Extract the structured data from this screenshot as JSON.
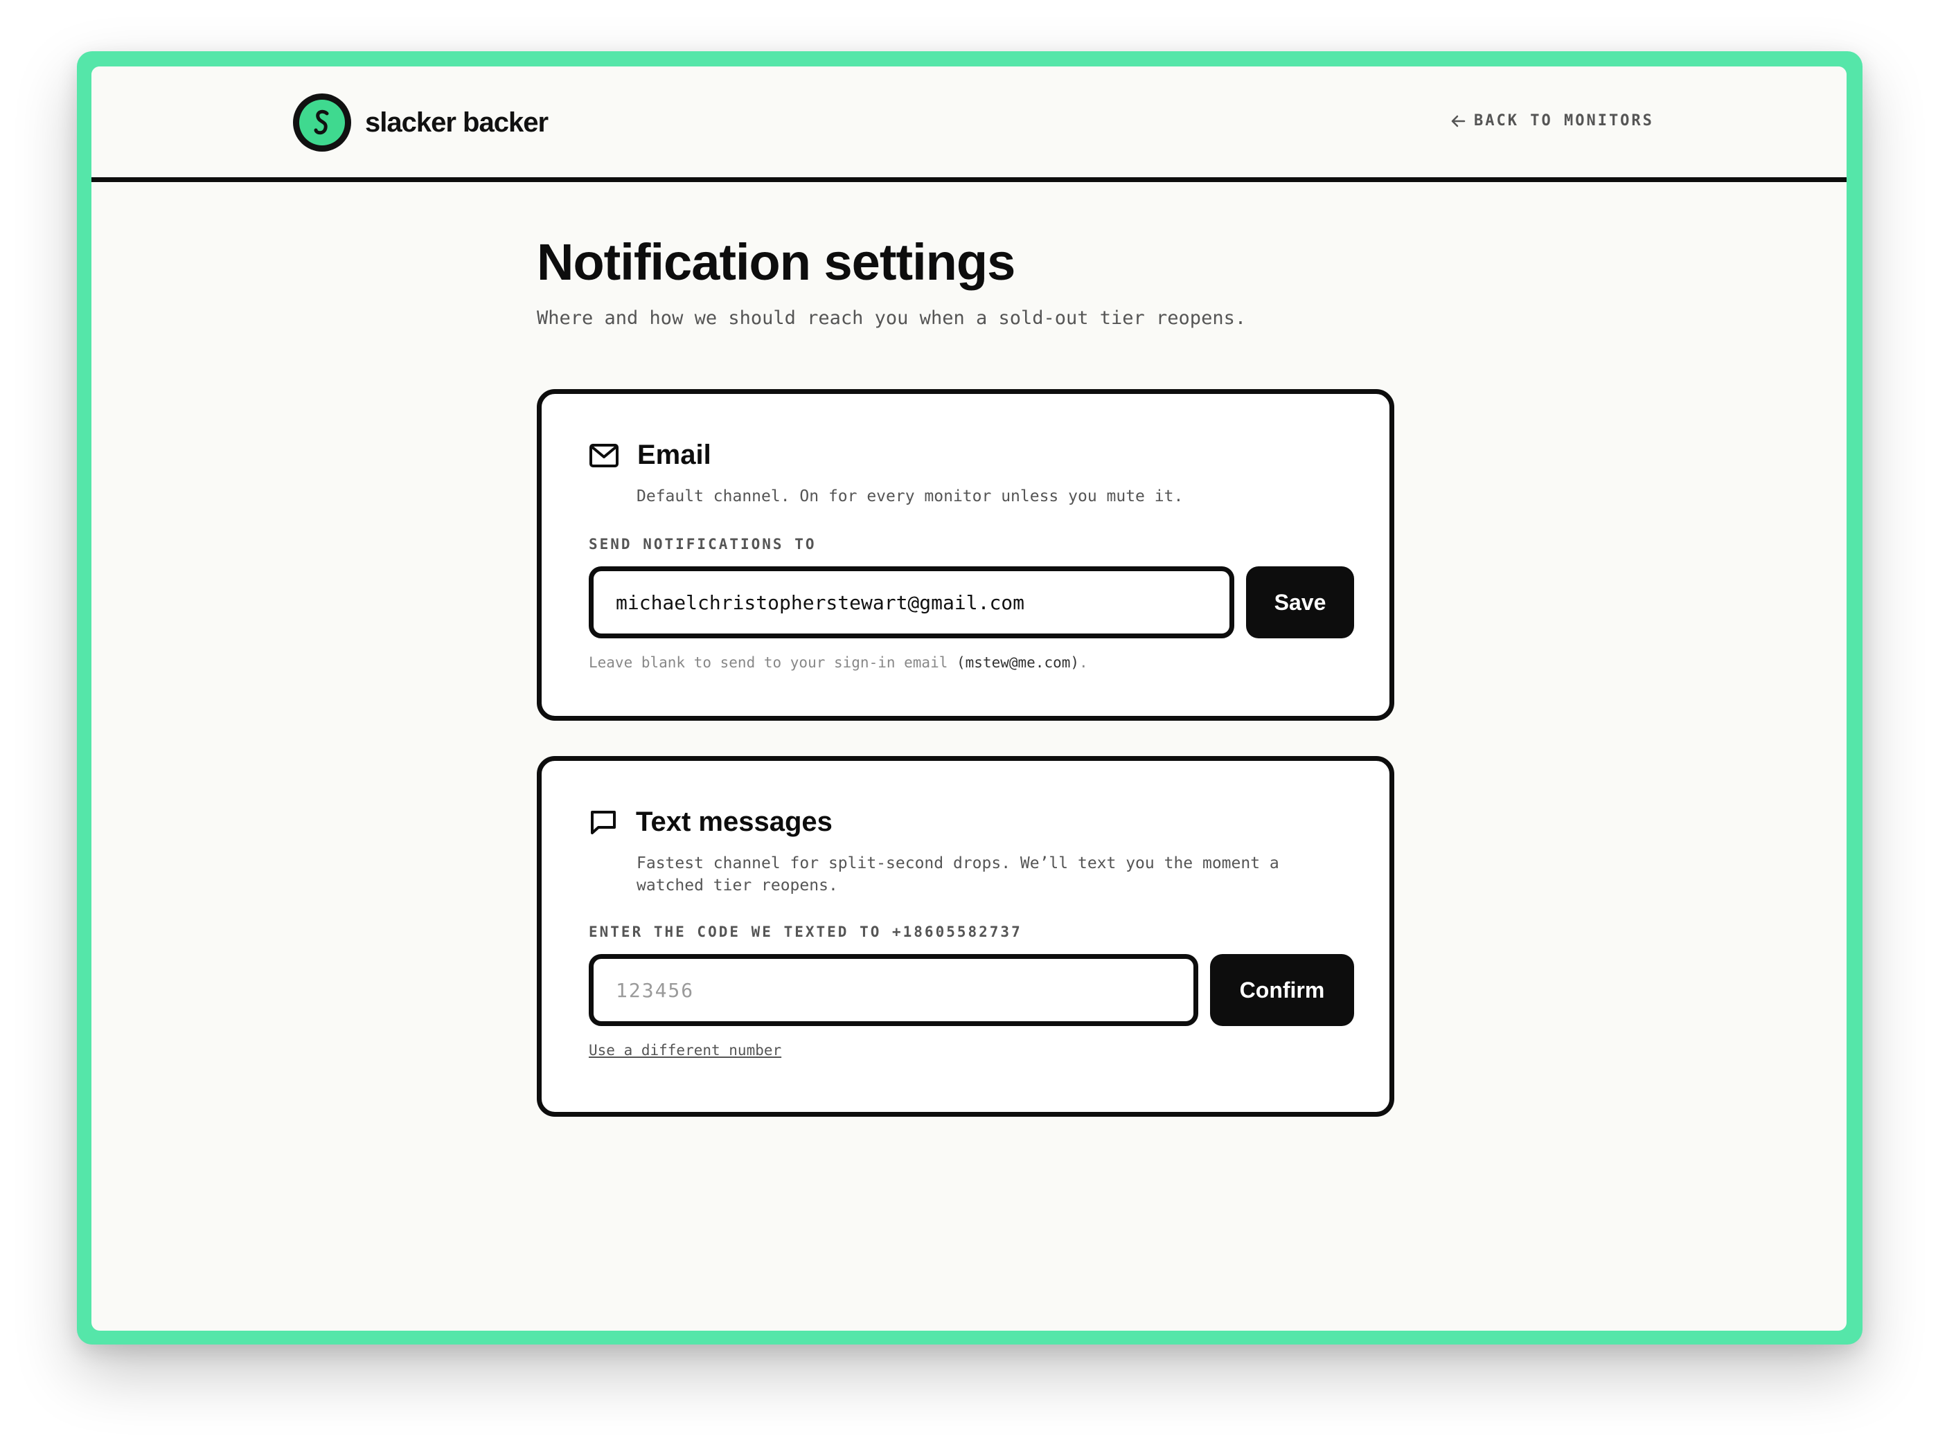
{
  "header": {
    "brand": "slacker backer",
    "back_link": "BACK TO MONITORS"
  },
  "page": {
    "title": "Notification settings",
    "subtitle": "Where and how we should reach you when a sold-out tier reopens."
  },
  "email_card": {
    "icon": "envelope-icon",
    "title": "Email",
    "description": "Default channel. On for every monitor unless you mute it.",
    "field_label": "SEND NOTIFICATIONS TO",
    "value": "michaelchristopherstewart@gmail.com",
    "save_label": "Save",
    "hint_prefix": "Leave blank to send to your sign-in email ",
    "hint_email": "(mstew@me.com)",
    "hint_suffix": "."
  },
  "sms_card": {
    "icon": "chat-bubble-icon",
    "title": "Text messages",
    "description": "Fastest channel for split-second drops. We’ll text you the moment a watched tier reopens.",
    "field_label": "ENTER THE CODE WE TEXTED TO +18605582737",
    "value": "",
    "placeholder": "123456",
    "confirm_label": "Confirm",
    "link": "Use a different number"
  },
  "colors": {
    "accent": "#55e6a9",
    "logo_green": "#3fd98f",
    "ink": "#0d0d0d",
    "background": "#fafaf7"
  }
}
